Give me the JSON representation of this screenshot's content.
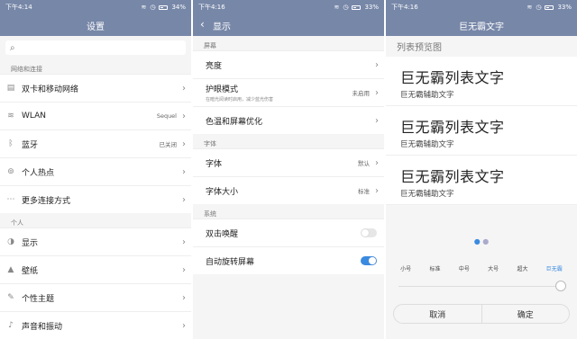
{
  "s1": {
    "status": {
      "time": "下午4:14",
      "battery": "34%"
    },
    "title": "设置",
    "search_placeholder": "",
    "sec1": "网络和连接",
    "rows1": [
      {
        "label": "双卡和移动网络",
        "value": "",
        "icon": "sim-icon"
      },
      {
        "label": "WLAN",
        "value": "Sequel",
        "icon": "wifi-icon"
      },
      {
        "label": "蓝牙",
        "value": "已关闭",
        "icon": "bluetooth-icon"
      },
      {
        "label": "个人热点",
        "value": "",
        "icon": "hotspot-icon"
      },
      {
        "label": "更多连接方式",
        "value": "",
        "icon": "more-icon"
      }
    ],
    "sec2": "个人",
    "rows2": [
      {
        "label": "显示",
        "value": "",
        "icon": "display-icon"
      },
      {
        "label": "壁纸",
        "value": "",
        "icon": "wallpaper-icon"
      },
      {
        "label": "个性主题",
        "value": "",
        "icon": "theme-icon"
      },
      {
        "label": "声音和振动",
        "value": "",
        "icon": "sound-icon"
      }
    ]
  },
  "s2": {
    "status": {
      "time": "下午4:16",
      "battery": "33%"
    },
    "title": "显示",
    "sec1": "屏幕",
    "rows1": [
      {
        "label": "亮度",
        "value": "",
        "sub": ""
      },
      {
        "label": "护眼模式",
        "value": "未启用",
        "sub": "在暗光阅读时启用，减少蓝光伤害"
      },
      {
        "label": "色温和屏幕优化",
        "value": "",
        "sub": ""
      }
    ],
    "sec2": "字体",
    "rows2": [
      {
        "label": "字体",
        "value": "默认"
      },
      {
        "label": "字体大小",
        "value": "标准"
      }
    ],
    "sec3": "系统",
    "rows3": [
      {
        "label": "双击唤醒",
        "on": false
      },
      {
        "label": "自动旋转屏幕",
        "on": true
      }
    ]
  },
  "s3": {
    "status": {
      "time": "下午4:16",
      "battery": "33%"
    },
    "title": "巨无霸文字",
    "preview_label": "列表预览图",
    "cards": [
      {
        "main": "巨无霸列表文字",
        "sub": "巨无霸辅助文字"
      },
      {
        "main": "巨无霸列表文字",
        "sub": "巨无霸辅助文字"
      },
      {
        "main": "巨无霸列表文字",
        "sub": "巨无霸辅助文字"
      }
    ],
    "sizes": [
      "小号",
      "标准",
      "中号",
      "大号",
      "超大",
      "巨无霸"
    ],
    "cancel": "取消",
    "confirm": "确定"
  }
}
